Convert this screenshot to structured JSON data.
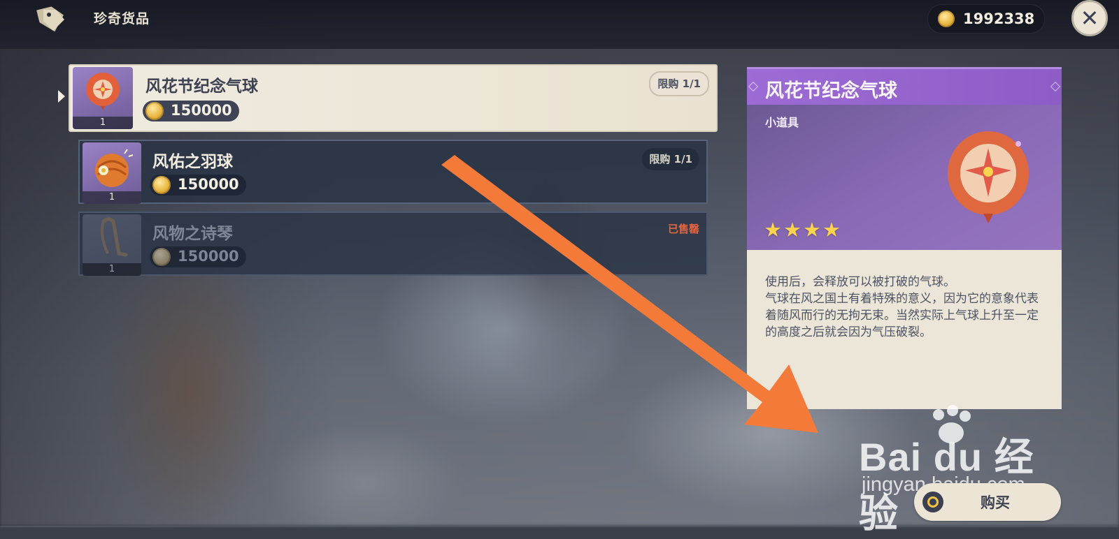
{
  "header": {
    "shop_title": "珍奇货品",
    "tag_icon": "price-tag-icon",
    "currency_amount": "1992338",
    "currency_icon": "mora-coin-icon",
    "close_icon": "close-icon"
  },
  "items": [
    {
      "name": "风花节纪念气球",
      "price": "150000",
      "count": "1",
      "status": "限购 1/1",
      "selected": true,
      "icon": "balloon-icon"
    },
    {
      "name": "风佑之羽球",
      "price": "150000",
      "count": "1",
      "status": "限购 1/1",
      "selected": false,
      "icon": "feather-ball-icon"
    },
    {
      "name": "风物之诗琴",
      "price": "150000",
      "count": "1",
      "status": "已售罄",
      "selected": false,
      "icon": "lyre-icon"
    }
  ],
  "detail": {
    "title": "风花节纪念气球",
    "type": "小道具",
    "rarity_stars": 4,
    "stars_text": "★★★★",
    "icon": "balloon-icon",
    "description": "使用后，会释放可以被打破的气球。\n气球在风之国土有着特殊的意义，因为它的意象代表着随风而行的无拘无束。当然实际上气球上升至一定的高度之后就会因为气压破裂。"
  },
  "buy": {
    "label": "购买",
    "icon": "buy-coin-icon"
  },
  "watermark": {
    "main": "Bai du 经验",
    "sub": "jingyan.baidu.com"
  },
  "colors": {
    "accent_purple": "#9d6bd4",
    "coin_gold": "#e8b63f",
    "sold_out_red": "#e9643f",
    "annotation_arrow": "#f47a3a"
  }
}
